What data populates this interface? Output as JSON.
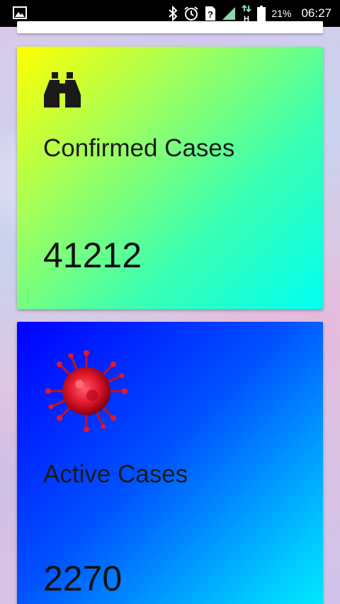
{
  "status_bar": {
    "battery_percent": "21%",
    "time": "06:27",
    "network_type": "H",
    "icons": [
      "image-icon",
      "bluetooth-icon",
      "alarm-icon",
      "no-sim-icon",
      "signal-icon",
      "battery-icon"
    ]
  },
  "cards": [
    {
      "title": "Confirmed Cases",
      "value": "41212",
      "icon": "binoculars-icon",
      "gradient_start": "#ffff00",
      "gradient_end": "#00fff2"
    },
    {
      "title": "Active Cases",
      "value": "2270",
      "icon": "virus-icon",
      "gradient_start": "#0000ff",
      "gradient_end": "#00f0ff"
    }
  ]
}
